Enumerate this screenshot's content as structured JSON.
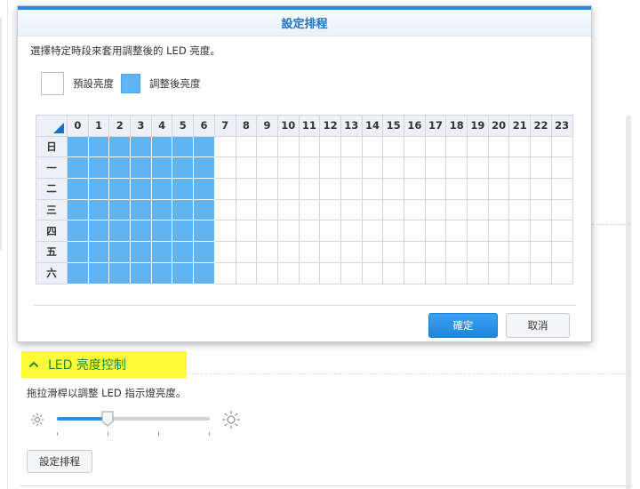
{
  "dialog": {
    "title": "設定排程",
    "description": "選擇特定時段來套用調整後的 LED 亮度。",
    "legend": {
      "default_label": "預設亮度",
      "adjusted_label": "調整後亮度"
    },
    "hours": [
      "0",
      "1",
      "2",
      "3",
      "4",
      "5",
      "6",
      "7",
      "8",
      "9",
      "10",
      "11",
      "12",
      "13",
      "14",
      "15",
      "16",
      "17",
      "18",
      "19",
      "20",
      "21",
      "22",
      "23"
    ],
    "days": [
      "日",
      "一",
      "二",
      "三",
      "四",
      "五",
      "六"
    ],
    "schedule_on_hours": [
      0,
      1,
      2,
      3,
      4,
      5,
      6
    ],
    "ok_label": "確定",
    "cancel_label": "取消"
  },
  "section": {
    "title": "LED 亮度控制"
  },
  "slider": {
    "description": "拖拉滑桿以調整 LED 指示燈亮度。",
    "value_fraction": 0.33
  },
  "schedule_button_label": "設定排程",
  "colors": {
    "accent": "#1e8ae0",
    "cell_on": "#5fb5f3",
    "highlight": "#fdfb37",
    "section_title": "#1f8a3b"
  }
}
